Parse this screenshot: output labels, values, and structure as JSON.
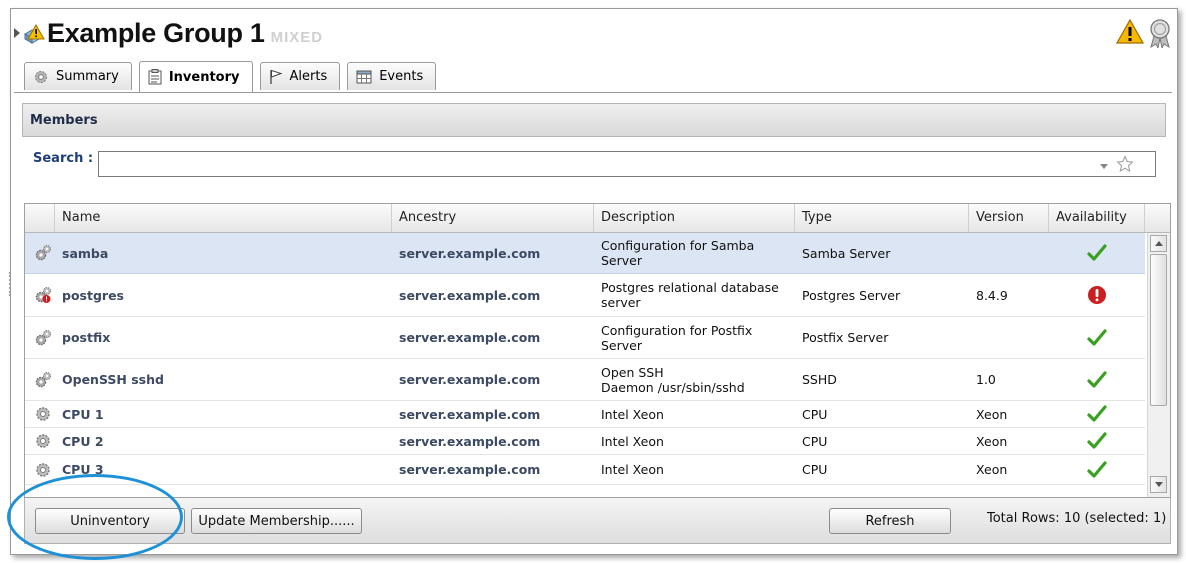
{
  "header": {
    "title": "Example Group 1",
    "subtitle": "MIXED",
    "group_icon": "group-warning-icon",
    "warning_icon": "warning-icon",
    "badge_icon": "award-badge-icon"
  },
  "tabs": [
    {
      "label": "Summary",
      "icon": "gear-icon",
      "active": false
    },
    {
      "label": "Inventory",
      "icon": "clipboard-icon",
      "active": true
    },
    {
      "label": "Alerts",
      "icon": "flag-icon",
      "active": false
    },
    {
      "label": "Events",
      "icon": "calendar-grid-icon",
      "active": false
    }
  ],
  "members": {
    "section_title": "Members",
    "search_label": "Search :",
    "search_value": "",
    "columns": [
      "Name",
      "Ancestry",
      "Description",
      "Type",
      "Version",
      "Availability"
    ],
    "rows": [
      {
        "icon": "service-gear-icon",
        "name": "samba",
        "ancestry": "server.example.com",
        "description": [
          "Configuration for Samba",
          "Server"
        ],
        "type": "Samba Server",
        "version": "",
        "availability": "up",
        "selected": true
      },
      {
        "icon": "service-gear-error-icon",
        "name": "postgres",
        "ancestry": "server.example.com",
        "description": [
          "Postgres relational database",
          "server"
        ],
        "type": "Postgres Server",
        "version": "8.4.9",
        "availability": "down",
        "selected": false
      },
      {
        "icon": "service-gear-icon",
        "name": "postfix",
        "ancestry": "server.example.com",
        "description": [
          "Configuration for Postfix",
          "Server"
        ],
        "type": "Postfix Server",
        "version": "",
        "availability": "up",
        "selected": false
      },
      {
        "icon": "service-gear-icon",
        "name": "OpenSSH sshd",
        "ancestry": "server.example.com",
        "description": [
          "Open SSH",
          "Daemon /usr/sbin/sshd"
        ],
        "type": "SSHD",
        "version": "1.0",
        "availability": "up",
        "selected": false
      },
      {
        "icon": "cpu-gear-icon",
        "name": "CPU 1",
        "ancestry": "server.example.com",
        "description": [
          "Intel Xeon"
        ],
        "type": "CPU",
        "version": "Xeon",
        "availability": "up",
        "selected": false
      },
      {
        "icon": "cpu-gear-icon",
        "name": "CPU 2",
        "ancestry": "server.example.com",
        "description": [
          "Intel Xeon"
        ],
        "type": "CPU",
        "version": "Xeon",
        "availability": "up",
        "selected": false
      },
      {
        "icon": "cpu-gear-icon",
        "name": "CPU 3",
        "ancestry": "server.example.com",
        "description": [
          "Intel Xeon"
        ],
        "type": "CPU",
        "version": "Xeon",
        "availability": "up",
        "selected": false
      }
    ],
    "buttons": {
      "uninventory": "Uninventory",
      "update_membership": "Update Membership......",
      "refresh": "Refresh"
    },
    "total_rows": "Total Rows: 10 (selected: 1)"
  },
  "colors": {
    "selection": "#dbe5f3",
    "link_text": "#3d4a63",
    "available": "#3aa020",
    "down": "#cc1f1f",
    "highlight_circle": "#1e90d6"
  }
}
